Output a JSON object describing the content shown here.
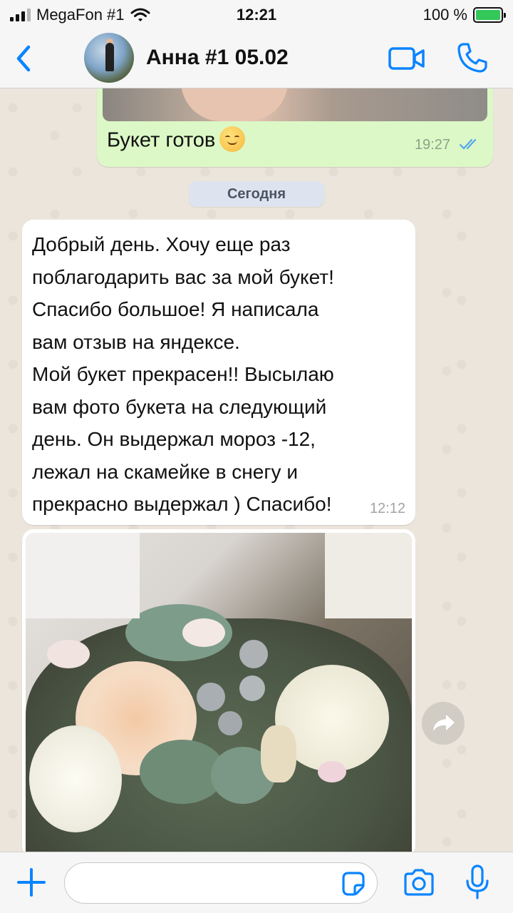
{
  "status_bar": {
    "carrier": "MegaFon #1",
    "time": "12:21",
    "battery_percent": "100 %",
    "battery_level": 1.0
  },
  "header": {
    "back_icon": "chevron-left-icon",
    "contact_name": "Анна #1 05.02",
    "video_icon": "video-camera-icon",
    "call_icon": "phone-icon"
  },
  "messages": {
    "outgoing": {
      "text": "Букет готов",
      "emoji": "smiling-face-emoji",
      "time": "19:27",
      "read": true
    },
    "date_separator": "Сегодня",
    "incoming": {
      "text": "Добрый день. Хочу еще раз\nпоблагодарить вас за мой букет!\nСпасибо большое! Я написала\nвам отзыв на яндексе.\nМой букет прекрасен!! Высылаю\nвам фото букета на следующий\nдень. Он выдержал мороз -12,\nлежал на скамейке в снегу и\nпрекрасно выдержал ) Спасибо!",
      "time": "12:12"
    },
    "photo_message": {
      "forward_icon": "forward-arrow-icon"
    }
  },
  "input_bar": {
    "placeholder": "",
    "plus_icon": "plus-icon",
    "sticker_icon": "sticker-icon",
    "camera_icon": "camera-icon",
    "mic_icon": "microphone-icon"
  },
  "colors": {
    "accent": "#0a84ff",
    "outgoing_bubble": "#dcf8c6",
    "incoming_bubble": "#ffffff",
    "chat_background": "#ebe5dc",
    "battery_fill": "#34c759"
  }
}
